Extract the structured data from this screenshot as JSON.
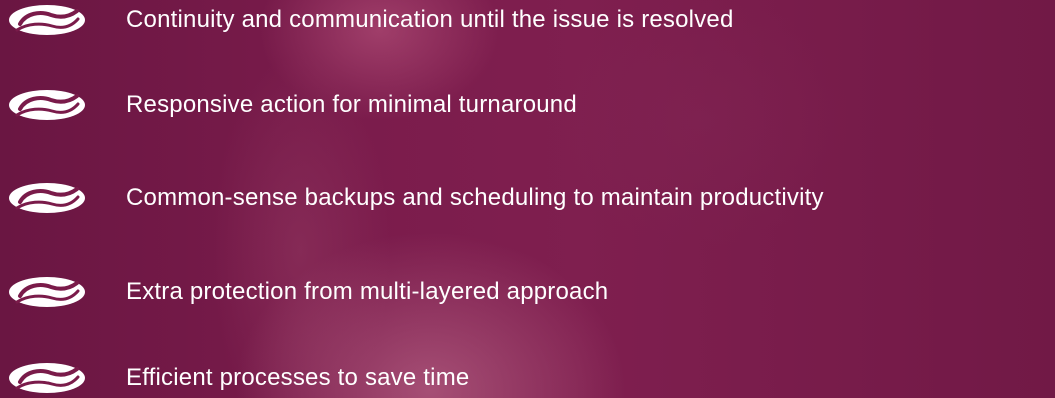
{
  "features": [
    {
      "icon": "logo-s-icon",
      "label": "Continuity and communication until the issue is resolved"
    },
    {
      "icon": "logo-s-icon",
      "label": "Responsive action for minimal turnaround"
    },
    {
      "icon": "logo-s-icon",
      "label": "Common-sense backups and scheduling to maintain productivity"
    },
    {
      "icon": "logo-s-icon",
      "label": "Extra protection from multi-layered approach"
    },
    {
      "icon": "logo-s-icon",
      "label": "Efficient processes to save time"
    }
  ]
}
